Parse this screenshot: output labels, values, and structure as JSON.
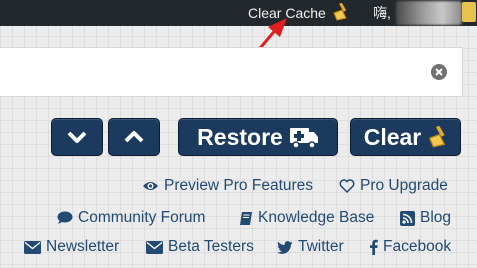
{
  "topbar": {
    "clear_cache_label": "Clear Cache",
    "greeting": "嗨,"
  },
  "search": {
    "value": "",
    "placeholder": ""
  },
  "actions": {
    "restore_label": "Restore",
    "clear_label": "Clear"
  },
  "links": {
    "preview_pro": "Preview Pro Features",
    "pro_upgrade": "Pro Upgrade",
    "community_forum": "Community Forum",
    "knowledge_base": "Knowledge Base",
    "blog": "Blog",
    "newsletter": "Newsletter",
    "beta_testers": "Beta Testers",
    "twitter": "Twitter",
    "facebook": "Facebook"
  },
  "colors": {
    "topbar_bg": "#23282d",
    "button_bg": "#1b3a5e",
    "link": "#234a72",
    "annotation_arrow": "#e02020",
    "broom_handle": "#e3a92a"
  }
}
